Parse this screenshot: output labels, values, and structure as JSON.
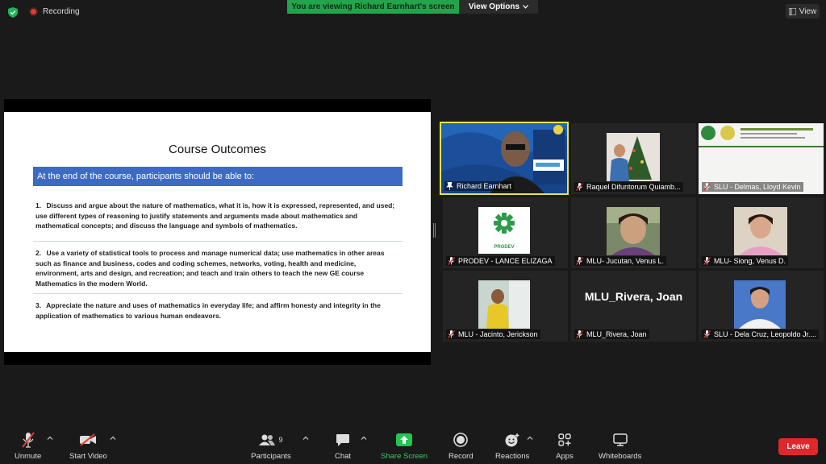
{
  "topbar": {
    "recording_label": "Recording",
    "viewing_banner": "You are viewing Richard Earnhart's screen",
    "view_options_label": "View Options",
    "view_label": "View"
  },
  "slide": {
    "title": "Course Outcomes",
    "band": "At the end of the course, participants should be able to:",
    "outcomes": [
      {
        "num": "1.",
        "text": "Discuss and argue about the nature of mathematics, what it is, how it is expressed, represented, and used; use different types of reasoning to justify statements and arguments made about mathematics and mathematical concepts; and discuss the language and symbols of mathematics."
      },
      {
        "num": "2.",
        "text": "Use a variety of statistical tools to process and manage numerical data; use mathematics in other areas such as finance and business, codes and coding schemes, networks, voting, health and medicine, environment, arts and design, and recreation; and teach and train others to teach the new GE course Mathematics in the modern World."
      },
      {
        "num": "3.",
        "text": "Appreciate the nature and uses of mathematics in everyday life; and affirm honesty and integrity in the application of mathematics to various human endeavors."
      }
    ]
  },
  "participants": [
    {
      "name": "Richard Earnhart"
    },
    {
      "name": "Raquel Difuntorum Quiamb..."
    },
    {
      "name": "SLU - Delmas, Lloyd Kevin"
    },
    {
      "name": "PRODEV - LANCE ELIZAGA",
      "logo_text": "PRODEV"
    },
    {
      "name": "MLU- Jucutan, Venus L."
    },
    {
      "name": "MLU- Siong, Venus D."
    },
    {
      "name": "MLU - Jacinto, Jerickson"
    },
    {
      "name": "MLU_Rivera, Joan",
      "display_text": "MLU_Rivera, Joan"
    },
    {
      "name": "SLU - Dela Cruz, Leopoldo Jr...."
    }
  ],
  "toolbar": {
    "unmute": "Unmute",
    "start_video": "Start Video",
    "participants": "Participants",
    "participants_count": "9",
    "chat": "Chat",
    "share_screen": "Share Screen",
    "record": "Record",
    "reactions": "Reactions",
    "apps": "Apps",
    "whiteboards": "Whiteboards",
    "leave": "Leave"
  },
  "colors": {
    "share_green": "#23a34b",
    "leave_red": "#e0272a",
    "slide_band_blue": "#3d6bc4",
    "active_speaker_border": "#e9e44a"
  }
}
